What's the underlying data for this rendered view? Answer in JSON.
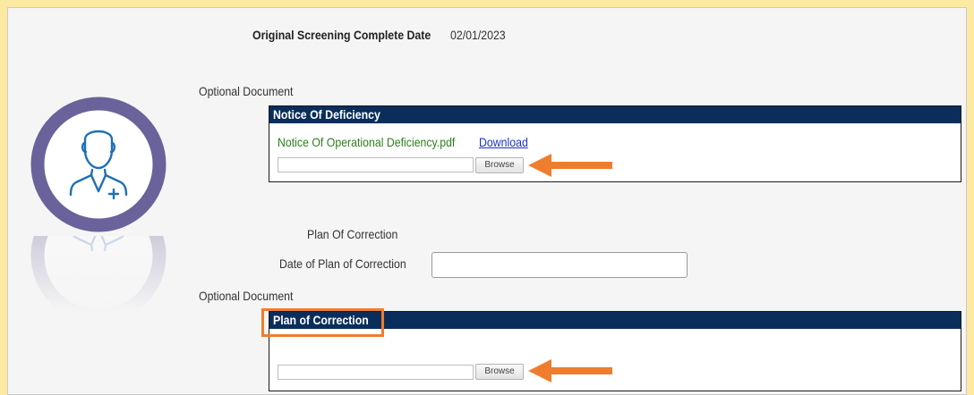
{
  "screening": {
    "label": "Original Screening Complete Date",
    "value": "02/01/2023"
  },
  "notice_section": {
    "optional_label": "Optional Document",
    "header": "Notice Of Deficiency",
    "file_name": "Notice Of Operational Deficiency.pdf",
    "download_label": "Download",
    "browse_label": "Browse"
  },
  "plan_section": {
    "heading": "Plan Of Correction",
    "date_label": "Date of Plan of Correction",
    "date_value": "",
    "optional_label": "Optional Document",
    "header": "Plan of Correction",
    "browse_label": "Browse"
  },
  "colors": {
    "page_bg": "#fce9a2",
    "header_bg": "#0a2e5c",
    "annotation": "#ef7d2e",
    "file_green": "#2e7d1e",
    "link_blue": "#1a33cc"
  },
  "icons": {
    "avatar": "user-plus-icon",
    "annotation_arrow": "left-arrow-icon"
  }
}
